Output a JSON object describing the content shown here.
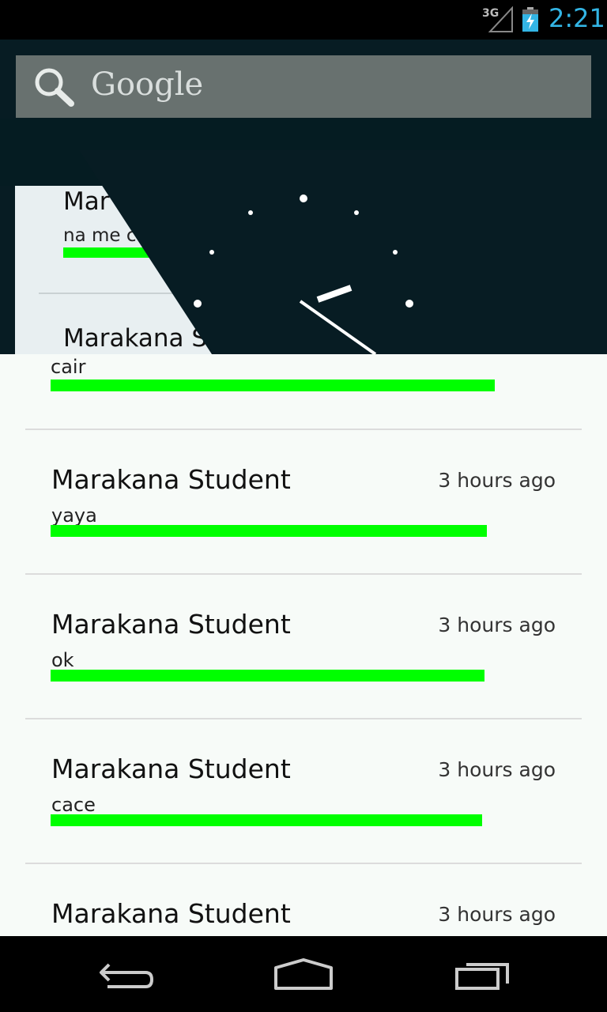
{
  "status_bar": {
    "network": "3G",
    "time": "2:21",
    "accent": "#33b5e5"
  },
  "search": {
    "label": "Google"
  },
  "ghost_card": {
    "name": "Mar",
    "message": "na me c",
    "name2": "Marakana S"
  },
  "feed": {
    "first_message": "cair",
    "items": [
      {
        "name": "Marakana Student",
        "time": "3 hours ago",
        "message": "yaya"
      },
      {
        "name": "Marakana Student",
        "time": "3 hours ago",
        "message": "ok"
      },
      {
        "name": "Marakana Student",
        "time": "3 hours ago",
        "message": "cace"
      },
      {
        "name": "Marakana Student",
        "time": "3 hours ago",
        "message": ""
      }
    ],
    "bar_color": "#00ff00"
  },
  "nav": {
    "icons": [
      "back-icon",
      "home-icon",
      "recent-apps-icon"
    ]
  }
}
